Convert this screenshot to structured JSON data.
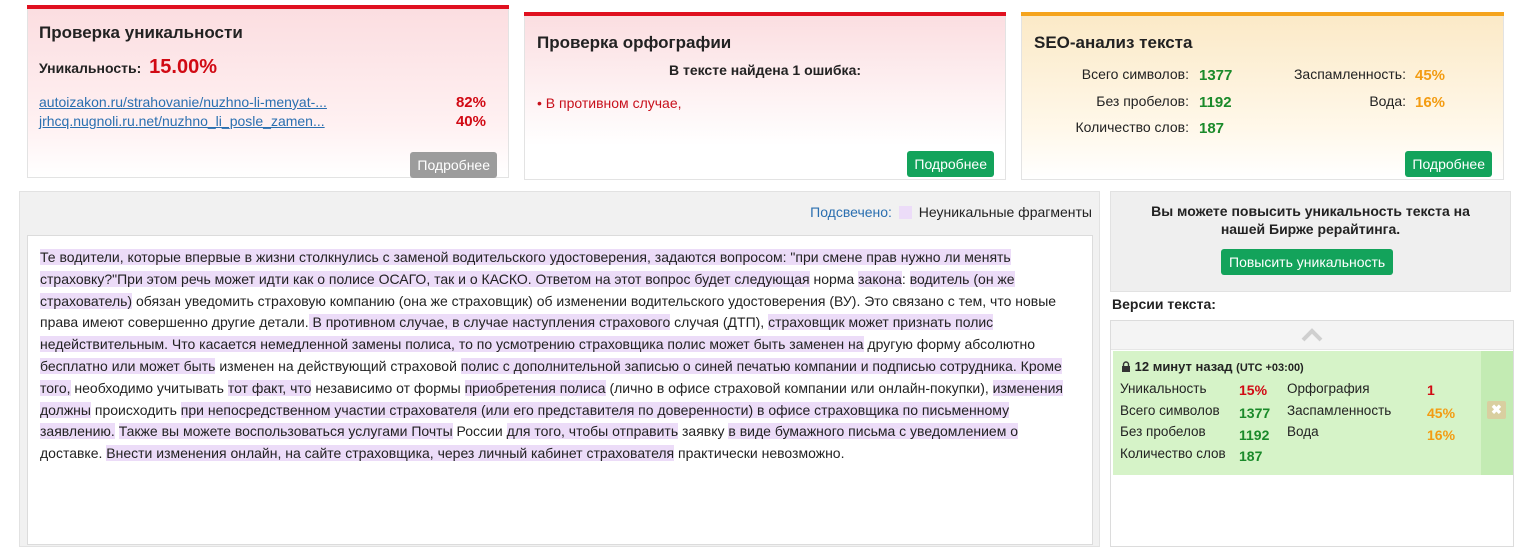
{
  "uniqueness_card": {
    "title": "Проверка уникальности",
    "label": "Уникальность:",
    "value": "15.00%",
    "sources": [
      {
        "url": "autoizakon.ru/strahovanie/nuzhno-li-menyat-...",
        "percent": "82%"
      },
      {
        "url": "jrhcq.nugnoli.ru.net/nuzhno_li_posle_zamen...",
        "percent": "40%"
      }
    ],
    "more_label": "Подробнее"
  },
  "spelling_card": {
    "title": "Проверка орфографии",
    "summary": "В тексте найдена 1 ошибка:",
    "errors": [
      "В противном случае,"
    ],
    "more_label": "Подробнее"
  },
  "seo_card": {
    "title": "SEO-анализ текста",
    "stats": {
      "total_chars_label": "Всего символов:",
      "total_chars": "1377",
      "no_spaces_label": "Без пробелов:",
      "no_spaces": "1192",
      "words_label": "Количество слов:",
      "words": "187",
      "spam_label": "Заспамленность:",
      "spam": "45%",
      "water_label": "Вода:",
      "water": "16%"
    },
    "more_label": "Подробнее"
  },
  "highlight_legend": {
    "label": "Подсвечено:",
    "text": "Неуникальные фрагменты",
    "color": "#ecdcf8"
  },
  "text_body": [
    {
      "t": "Те водители, которые впервые в жизни столкнулись с заменой водительского удостоверения, задаются вопросом: \"при смене прав нужно ли менять страховку?\"При этом речь может идти как о полисе ОСАГО, так и о КАСКО. Ответом на этот вопрос будет следующая",
      "h": true
    },
    {
      "t": " норма ",
      "h": false
    },
    {
      "t": "закона",
      "h": true
    },
    {
      "t": ": ",
      "h": false
    },
    {
      "t": "водитель (он же страхователь)",
      "h": true
    },
    {
      "t": " обязан уведомить страховую компанию (она же страховщик) об изменении водительского удостоверения (ВУ). Это связано с тем, что новые права имеют совершенно ",
      "h": false
    },
    {
      "t": "другие детали.",
      "h": false
    },
    {
      "t": " В противном случае, в случае наступления страхового",
      "h": true
    },
    {
      "t": " случая (ДТП), ",
      "h": false
    },
    {
      "t": "страховщик может признать полис недействительным.",
      "h": true
    },
    {
      "t": " Что касается немедленной замены полиса, то по усмотрению страховщика полис может быть заменен на",
      "h": true
    },
    {
      "t": " другую форму абсолютно ",
      "h": false
    },
    {
      "t": "бесплатно или может быть",
      "h": true
    },
    {
      "t": " изменен на действующий страховой ",
      "h": false
    },
    {
      "t": "полис с дополнительной записью о синей печатью компании и подписью сотрудника. Кроме того,",
      "h": true
    },
    {
      "t": " необходимо учитывать ",
      "h": false
    },
    {
      "t": "тот факт, что",
      "h": true
    },
    {
      "t": " независимо от формы ",
      "h": false
    },
    {
      "t": "приобретения полиса",
      "h": true
    },
    {
      "t": " (лично в офисе страховой компании или онлайн-покупки), ",
      "h": false
    },
    {
      "t": "изменения должны",
      "h": true
    },
    {
      "t": " происходить ",
      "h": false
    },
    {
      "t": "при непосредственном участии страхователя (или его представителя по доверенности) в офисе страховщика по письменному заявлению.",
      "h": true
    },
    {
      "t": " ",
      "h": false
    },
    {
      "t": "Также вы можете воспользоваться услугами Почты",
      "h": true
    },
    {
      "t": " России ",
      "h": false
    },
    {
      "t": "для того, чтобы отправить",
      "h": true
    },
    {
      "t": " заявку ",
      "h": false
    },
    {
      "t": "в виде бумажного письма с уведомлением о",
      "h": true
    },
    {
      "t": " доставке. ",
      "h": false
    },
    {
      "t": "Внести изменения онлайн, на сайте страховщика, через личный кабинет страхователя",
      "h": true
    },
    {
      "t": " практически невозможно.",
      "h": false
    }
  ],
  "raise_box": {
    "text": "Вы можете повысить уникальность текста на нашей Бирже рерайтинга.",
    "button_label": "Повысить уникальность"
  },
  "versions": {
    "title": "Версии текста:",
    "items": [
      {
        "time": "12 минут назад",
        "tz": "(UTC +03:00)",
        "uniq_label": "Уникальность",
        "uniq": "15%",
        "spell_label": "Орфография",
        "spell": "1",
        "total_label": "Всего символов",
        "total": "1377",
        "spam_label": "Заспамленность",
        "spam": "45%",
        "nospace_label": "Без пробелов",
        "nospace": "1192",
        "water_label": "Вода",
        "water": "16%",
        "words_label": "Количество слов",
        "words": "187"
      }
    ]
  },
  "colors": {
    "accent_red": "#e0101f",
    "accent_orange": "#f5a41d",
    "button_green": "#13a35b",
    "highlight": "#ecdcf8"
  }
}
